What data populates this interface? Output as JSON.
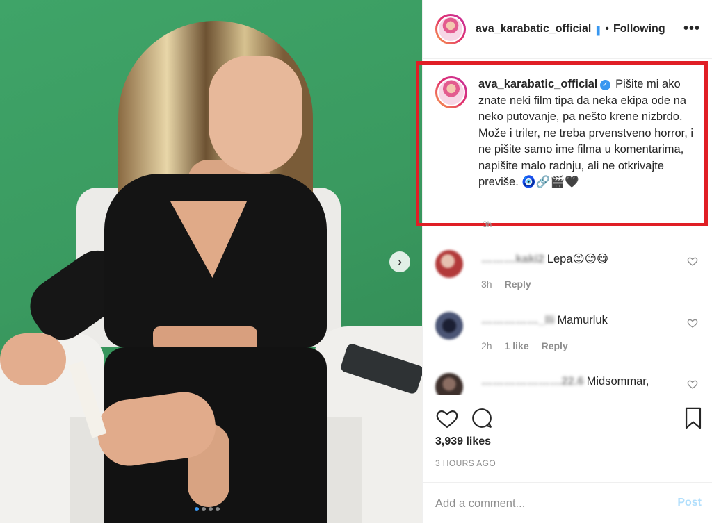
{
  "header": {
    "username": "ava_karabatic_official",
    "verified_glyph": "❚",
    "separator": "•",
    "follow_status": "Following",
    "more_label": "•••"
  },
  "carousel": {
    "next_glyph": "›",
    "dots": 4,
    "active_dot": 0
  },
  "caption": {
    "username": "ava_karabatic_official",
    "badge_glyph": "✓",
    "text": "Pišite mi ako znate neki film tipa da neka ekipa ode na neko putovanje, pa nešto krene nizbrdo. Može i triler, ne treba prvenstveno horror, i ne pišite samo ime filma u komentarima, napišite malo radnju, ali ne otkrivajte previše. 🧿🔗🎬🖤",
    "time": "3h"
  },
  "comments": [
    {
      "user": "………kaki2",
      "text": "Lepa😊😊😋",
      "time": "3h",
      "likes": "",
      "reply_label": "Reply",
      "avatar_color": "#b23a3a"
    },
    {
      "user": "……………_lli",
      "text": "Mamurluk",
      "time": "2h",
      "likes": "1 like",
      "reply_label": "Reply",
      "avatar_color": "#2a3358"
    },
    {
      "user": "…………………22.6",
      "text": "Midsommar,",
      "time": "",
      "likes": "",
      "reply_label": "",
      "avatar_color": "#4a3a36"
    }
  ],
  "actions": {
    "likes": "3,939 likes",
    "posted_ago": "3 HOURS AGO",
    "comment_placeholder": "Add a comment...",
    "post_label": "Post"
  },
  "colors": {
    "accent": "#3897f0",
    "highlight_box": "#e01e25",
    "post_disabled": "#b2dffc"
  }
}
